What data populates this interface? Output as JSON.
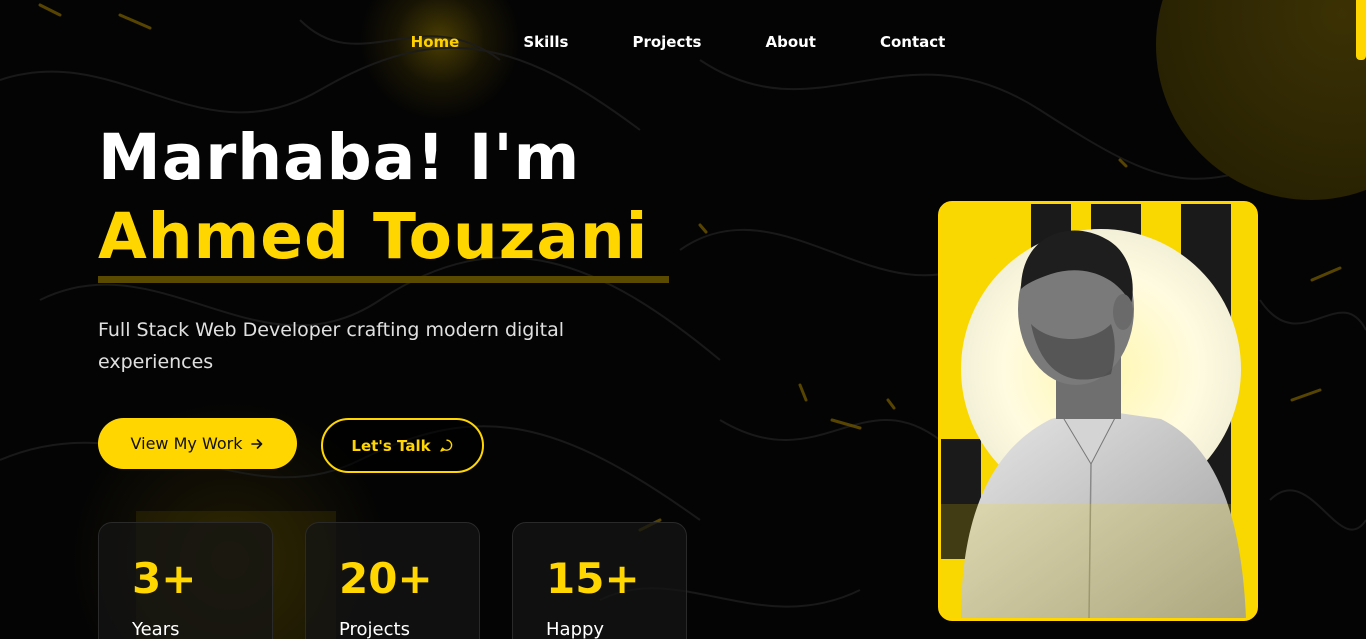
{
  "nav": {
    "items": [
      "Home",
      "Skills",
      "Projects",
      "About",
      "Contact"
    ],
    "active": "Home"
  },
  "hero": {
    "greeting": "Marhaba! I'm",
    "name": "Ahmed Touzani",
    "subtitle": "Full Stack Web Developer crafting modern digital experiences"
  },
  "buttons": {
    "primary_label": "View My Work",
    "primary_icon": "arrow-right-icon",
    "secondary_label": "Let's Talk",
    "secondary_icon": "chat-bubble-icon"
  },
  "stats": [
    {
      "value": "3+",
      "label": "Years"
    },
    {
      "value": "20+",
      "label": "Projects"
    },
    {
      "value": "15+",
      "label": "Happy"
    }
  ],
  "colors": {
    "accent": "#ffd600",
    "background": "#040404",
    "text": "#ffffff"
  }
}
